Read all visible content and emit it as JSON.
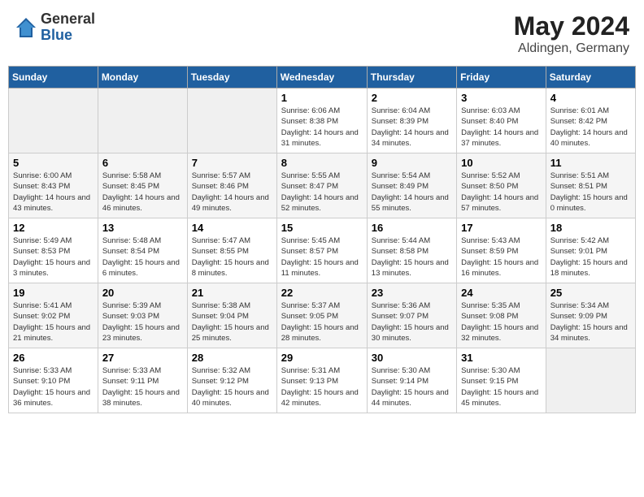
{
  "header": {
    "logo_general": "General",
    "logo_blue": "Blue",
    "month_title": "May 2024",
    "location": "Aldingen, Germany"
  },
  "days_of_week": [
    "Sunday",
    "Monday",
    "Tuesday",
    "Wednesday",
    "Thursday",
    "Friday",
    "Saturday"
  ],
  "weeks": [
    [
      {
        "day": "",
        "sunrise": "",
        "sunset": "",
        "daylight": ""
      },
      {
        "day": "",
        "sunrise": "",
        "sunset": "",
        "daylight": ""
      },
      {
        "day": "",
        "sunrise": "",
        "sunset": "",
        "daylight": ""
      },
      {
        "day": "1",
        "sunrise": "Sunrise: 6:06 AM",
        "sunset": "Sunset: 8:38 PM",
        "daylight": "Daylight: 14 hours and 31 minutes."
      },
      {
        "day": "2",
        "sunrise": "Sunrise: 6:04 AM",
        "sunset": "Sunset: 8:39 PM",
        "daylight": "Daylight: 14 hours and 34 minutes."
      },
      {
        "day": "3",
        "sunrise": "Sunrise: 6:03 AM",
        "sunset": "Sunset: 8:40 PM",
        "daylight": "Daylight: 14 hours and 37 minutes."
      },
      {
        "day": "4",
        "sunrise": "Sunrise: 6:01 AM",
        "sunset": "Sunset: 8:42 PM",
        "daylight": "Daylight: 14 hours and 40 minutes."
      }
    ],
    [
      {
        "day": "5",
        "sunrise": "Sunrise: 6:00 AM",
        "sunset": "Sunset: 8:43 PM",
        "daylight": "Daylight: 14 hours and 43 minutes."
      },
      {
        "day": "6",
        "sunrise": "Sunrise: 5:58 AM",
        "sunset": "Sunset: 8:45 PM",
        "daylight": "Daylight: 14 hours and 46 minutes."
      },
      {
        "day": "7",
        "sunrise": "Sunrise: 5:57 AM",
        "sunset": "Sunset: 8:46 PM",
        "daylight": "Daylight: 14 hours and 49 minutes."
      },
      {
        "day": "8",
        "sunrise": "Sunrise: 5:55 AM",
        "sunset": "Sunset: 8:47 PM",
        "daylight": "Daylight: 14 hours and 52 minutes."
      },
      {
        "day": "9",
        "sunrise": "Sunrise: 5:54 AM",
        "sunset": "Sunset: 8:49 PM",
        "daylight": "Daylight: 14 hours and 55 minutes."
      },
      {
        "day": "10",
        "sunrise": "Sunrise: 5:52 AM",
        "sunset": "Sunset: 8:50 PM",
        "daylight": "Daylight: 14 hours and 57 minutes."
      },
      {
        "day": "11",
        "sunrise": "Sunrise: 5:51 AM",
        "sunset": "Sunset: 8:51 PM",
        "daylight": "Daylight: 15 hours and 0 minutes."
      }
    ],
    [
      {
        "day": "12",
        "sunrise": "Sunrise: 5:49 AM",
        "sunset": "Sunset: 8:53 PM",
        "daylight": "Daylight: 15 hours and 3 minutes."
      },
      {
        "day": "13",
        "sunrise": "Sunrise: 5:48 AM",
        "sunset": "Sunset: 8:54 PM",
        "daylight": "Daylight: 15 hours and 6 minutes."
      },
      {
        "day": "14",
        "sunrise": "Sunrise: 5:47 AM",
        "sunset": "Sunset: 8:55 PM",
        "daylight": "Daylight: 15 hours and 8 minutes."
      },
      {
        "day": "15",
        "sunrise": "Sunrise: 5:45 AM",
        "sunset": "Sunset: 8:57 PM",
        "daylight": "Daylight: 15 hours and 11 minutes."
      },
      {
        "day": "16",
        "sunrise": "Sunrise: 5:44 AM",
        "sunset": "Sunset: 8:58 PM",
        "daylight": "Daylight: 15 hours and 13 minutes."
      },
      {
        "day": "17",
        "sunrise": "Sunrise: 5:43 AM",
        "sunset": "Sunset: 8:59 PM",
        "daylight": "Daylight: 15 hours and 16 minutes."
      },
      {
        "day": "18",
        "sunrise": "Sunrise: 5:42 AM",
        "sunset": "Sunset: 9:01 PM",
        "daylight": "Daylight: 15 hours and 18 minutes."
      }
    ],
    [
      {
        "day": "19",
        "sunrise": "Sunrise: 5:41 AM",
        "sunset": "Sunset: 9:02 PM",
        "daylight": "Daylight: 15 hours and 21 minutes."
      },
      {
        "day": "20",
        "sunrise": "Sunrise: 5:39 AM",
        "sunset": "Sunset: 9:03 PM",
        "daylight": "Daylight: 15 hours and 23 minutes."
      },
      {
        "day": "21",
        "sunrise": "Sunrise: 5:38 AM",
        "sunset": "Sunset: 9:04 PM",
        "daylight": "Daylight: 15 hours and 25 minutes."
      },
      {
        "day": "22",
        "sunrise": "Sunrise: 5:37 AM",
        "sunset": "Sunset: 9:05 PM",
        "daylight": "Daylight: 15 hours and 28 minutes."
      },
      {
        "day": "23",
        "sunrise": "Sunrise: 5:36 AM",
        "sunset": "Sunset: 9:07 PM",
        "daylight": "Daylight: 15 hours and 30 minutes."
      },
      {
        "day": "24",
        "sunrise": "Sunrise: 5:35 AM",
        "sunset": "Sunset: 9:08 PM",
        "daylight": "Daylight: 15 hours and 32 minutes."
      },
      {
        "day": "25",
        "sunrise": "Sunrise: 5:34 AM",
        "sunset": "Sunset: 9:09 PM",
        "daylight": "Daylight: 15 hours and 34 minutes."
      }
    ],
    [
      {
        "day": "26",
        "sunrise": "Sunrise: 5:33 AM",
        "sunset": "Sunset: 9:10 PM",
        "daylight": "Daylight: 15 hours and 36 minutes."
      },
      {
        "day": "27",
        "sunrise": "Sunrise: 5:33 AM",
        "sunset": "Sunset: 9:11 PM",
        "daylight": "Daylight: 15 hours and 38 minutes."
      },
      {
        "day": "28",
        "sunrise": "Sunrise: 5:32 AM",
        "sunset": "Sunset: 9:12 PM",
        "daylight": "Daylight: 15 hours and 40 minutes."
      },
      {
        "day": "29",
        "sunrise": "Sunrise: 5:31 AM",
        "sunset": "Sunset: 9:13 PM",
        "daylight": "Daylight: 15 hours and 42 minutes."
      },
      {
        "day": "30",
        "sunrise": "Sunrise: 5:30 AM",
        "sunset": "Sunset: 9:14 PM",
        "daylight": "Daylight: 15 hours and 44 minutes."
      },
      {
        "day": "31",
        "sunrise": "Sunrise: 5:30 AM",
        "sunset": "Sunset: 9:15 PM",
        "daylight": "Daylight: 15 hours and 45 minutes."
      },
      {
        "day": "",
        "sunrise": "",
        "sunset": "",
        "daylight": ""
      }
    ]
  ]
}
